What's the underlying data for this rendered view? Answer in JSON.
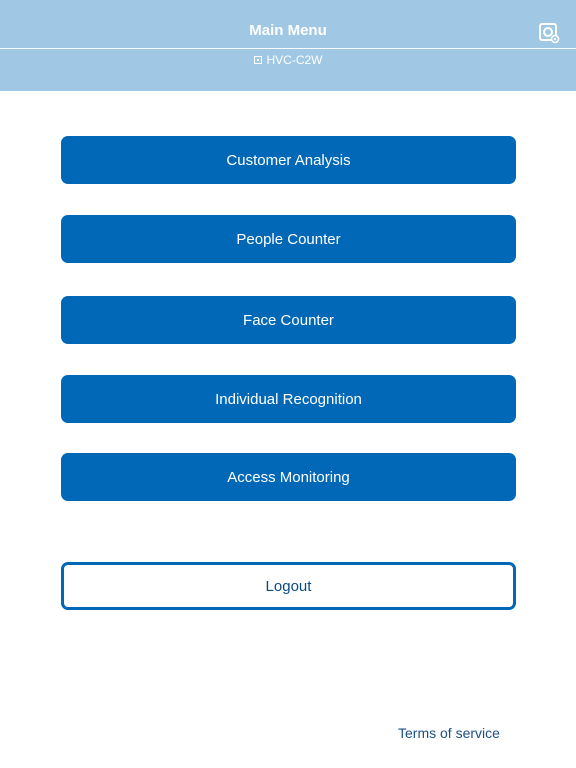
{
  "header": {
    "title": "Main Menu",
    "device_name": "HVC-C2W",
    "device_icon": "camera-device-icon",
    "settings_icon": "camera-settings-icon"
  },
  "menu": {
    "items": [
      {
        "label": "Customer Analysis"
      },
      {
        "label": "People Counter"
      },
      {
        "label": "Face Counter"
      },
      {
        "label": "Individual Recognition"
      },
      {
        "label": "Access Monitoring"
      }
    ]
  },
  "logout_label": "Logout",
  "terms_label": "Terms of service",
  "colors": {
    "header_bg": "#a0c8e4",
    "button_bg": "#0068b7",
    "logout_border": "#0068b7",
    "link_text": "#1c4f86"
  }
}
